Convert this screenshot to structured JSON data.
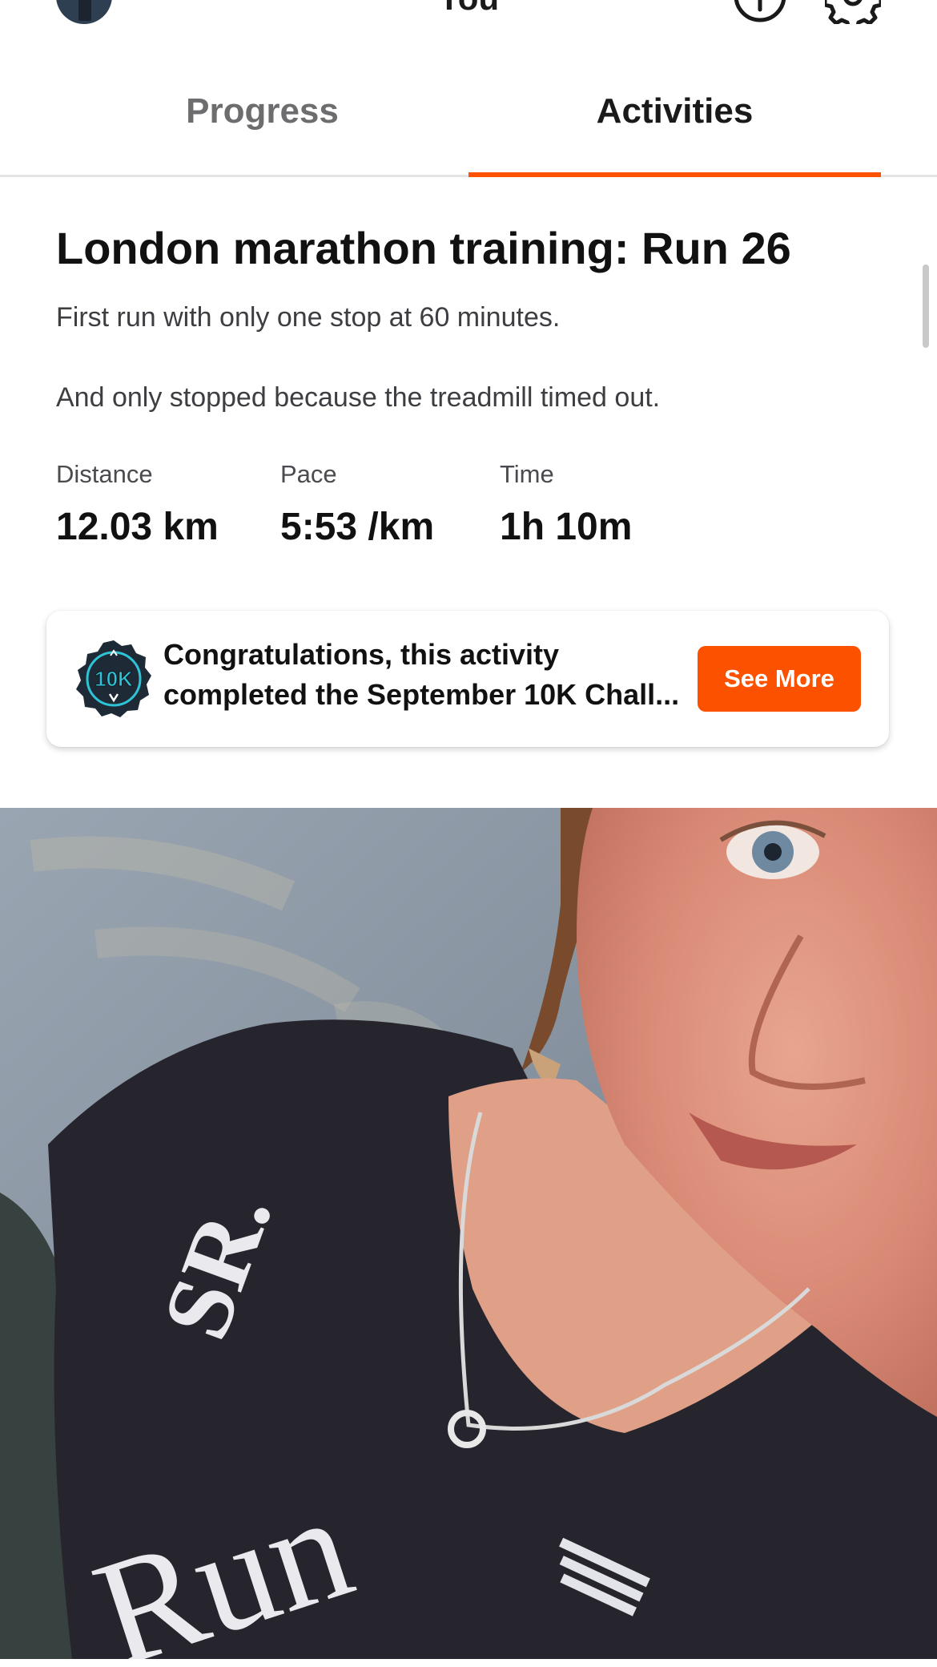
{
  "header": {
    "title": "You",
    "avatar_icon": "avatar-icon",
    "info_icon": "info-icon",
    "settings_icon": "gear-icon"
  },
  "tabs": [
    {
      "label": "Progress",
      "active": false
    },
    {
      "label": "Activities",
      "active": true
    }
  ],
  "activity": {
    "title": "London marathon training: Run 26",
    "description": [
      "First run with only one stop at 60 minutes.",
      "And only stopped because the treadmill timed out."
    ],
    "stats": {
      "distance": {
        "label": "Distance",
        "value": "12.03 km"
      },
      "pace": {
        "label": "Pace",
        "value": "5:53 /km"
      },
      "time": {
        "label": "Time",
        "value": "1h 10m"
      }
    }
  },
  "achievement": {
    "badge_text": "10K",
    "line1": "Congratulations, this activity",
    "line2": "completed the September 10K Chall...",
    "button_label": "See More"
  },
  "colors": {
    "accent": "#fc5200",
    "text_primary": "#111111",
    "text_secondary": "#4a4a4f",
    "badge_teal": "#2ec4d6"
  },
  "photo": {
    "shirt_text": "Run",
    "shirt_logo": "SR."
  }
}
